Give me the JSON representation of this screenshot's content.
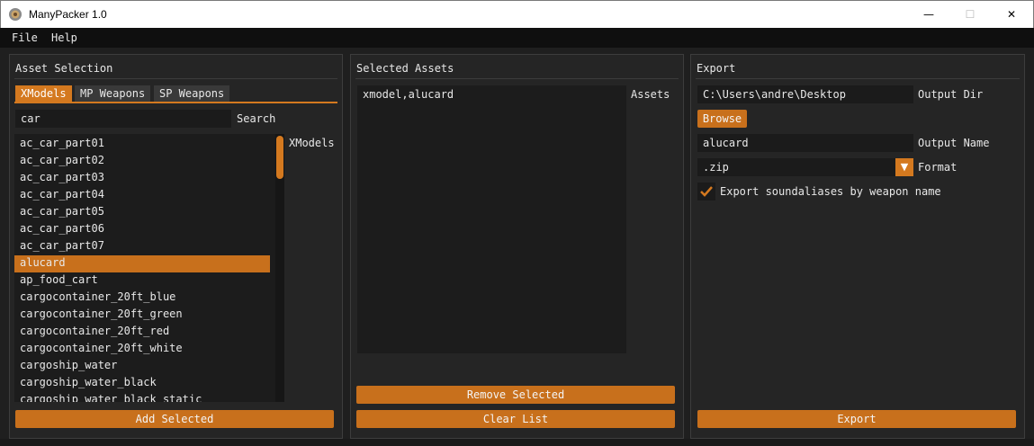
{
  "window": {
    "title": "ManyPacker 1.0",
    "icon": "app-gear-icon",
    "controls": {
      "minimize": "—",
      "maximize": "☐",
      "close": "✕"
    }
  },
  "menu": {
    "items": [
      "File",
      "Help"
    ]
  },
  "asset_selection": {
    "title": "Asset Selection",
    "tabs": [
      "XModels",
      "MP Weapons",
      "SP Weapons"
    ],
    "active_tab": "XModels",
    "search": {
      "value": "car",
      "label": "Search"
    },
    "list_label": "XModels",
    "items": [
      "ac_car_part01",
      "ac_car_part02",
      "ac_car_part03",
      "ac_car_part04",
      "ac_car_part05",
      "ac_car_part06",
      "ac_car_part07",
      "alucard",
      "ap_food_cart",
      "cargocontainer_20ft_blue",
      "cargocontainer_20ft_green",
      "cargocontainer_20ft_red",
      "cargocontainer_20ft_white",
      "cargoship_water",
      "cargoship_water_black",
      "cargoship_water_black_static"
    ],
    "selected_item": "alucard",
    "add_button": "Add Selected"
  },
  "selected_assets": {
    "title": "Selected Assets",
    "assets_label": "Assets",
    "items": [
      "xmodel,alucard"
    ],
    "remove_button": "Remove Selected",
    "clear_button": "Clear List"
  },
  "export": {
    "title": "Export",
    "output_dir": {
      "value": "C:\\Users\\andre\\Desktop",
      "label": "Output Dir"
    },
    "browse_button": "Browse",
    "output_name": {
      "value": "alucard",
      "label": "Output Name"
    },
    "format": {
      "value": ".zip",
      "label": "Format",
      "arrow": "▼"
    },
    "soundaliases_checkbox": {
      "label": "Export soundaliases by weapon name",
      "checked": true
    },
    "export_button": "Export"
  },
  "colors": {
    "accent": "#d4791f",
    "panel": "#252525",
    "background": "#1f1f1f",
    "field": "#1b1b1b"
  }
}
